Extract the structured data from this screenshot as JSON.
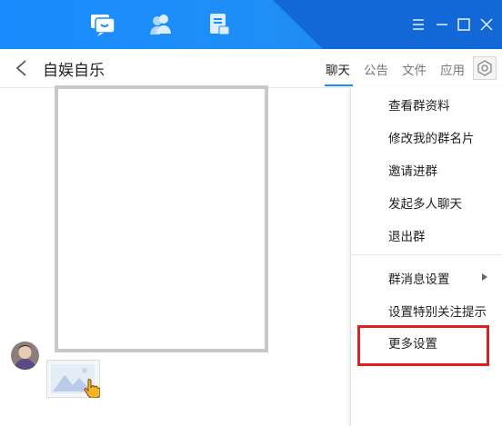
{
  "topbar": {
    "nav_icons": [
      "chat-bubble-icon",
      "contacts-icon",
      "files-icon"
    ],
    "window_icons": [
      "menu-icon",
      "minimize-icon",
      "maximize-icon",
      "close-icon"
    ],
    "colors": {
      "primary": "#1a8cff",
      "diagonal": "#1168d6"
    }
  },
  "header": {
    "title": "自娱自乐",
    "tabs": [
      {
        "label": "聊天",
        "active": true
      },
      {
        "label": "公告",
        "active": false
      },
      {
        "label": "文件",
        "active": false
      },
      {
        "label": "应用",
        "active": false
      }
    ]
  },
  "menu": {
    "items": [
      "查看群资料",
      "修改我的群名片",
      "邀请进群",
      "发起多人聊天",
      "退出群",
      "群消息设置",
      "设置特别关注提示",
      "更多设置"
    ],
    "highlighted": "更多设置",
    "highlight_color": "#e02020"
  }
}
